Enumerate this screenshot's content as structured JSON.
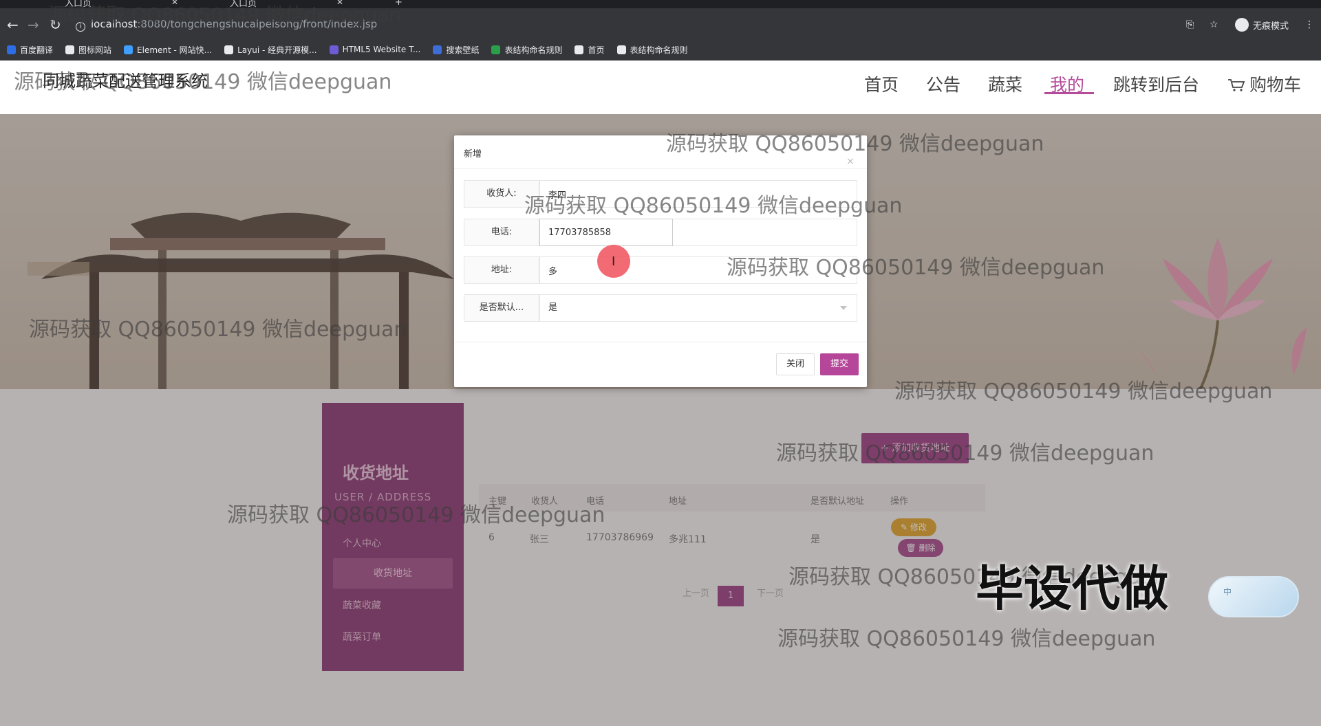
{
  "browser": {
    "tabs": [
      {
        "title": "入口页"
      },
      {
        "title": "入口页"
      }
    ],
    "url_host": "localhost",
    "url_path": ":8080/tongchengshucaipeisong/front/index.jsp",
    "profile_label": "无痕模式",
    "bookmarks": [
      {
        "label": "百度翻译",
        "color": "#2d6ee6"
      },
      {
        "label": "图标网站",
        "color": "#e8eaed"
      },
      {
        "label": "Element - 网站快...",
        "color": "#409eff"
      },
      {
        "label": "Layui - 经典开源模...",
        "color": "#e8eaed"
      },
      {
        "label": "HTML5 Website T...",
        "color": "#6f5bd6"
      },
      {
        "label": "搜索壁纸",
        "color": "#3f6dd8"
      },
      {
        "label": "表结构命名规则",
        "color": "#2aa04a"
      },
      {
        "label": "首页",
        "color": "#e8eaed"
      },
      {
        "label": "表结构命名规则",
        "color": "#e8eaed"
      }
    ]
  },
  "site": {
    "brand": "同城蔬菜配送管理系统",
    "nav": [
      {
        "label": "首页"
      },
      {
        "label": "公告"
      },
      {
        "label": "蔬菜"
      },
      {
        "label": "我的",
        "active": true
      },
      {
        "label": "跳转到后台"
      },
      {
        "label": "购物车"
      }
    ],
    "accent_color": "#b54b9a"
  },
  "sidebar": {
    "title": "收货地址",
    "subtitle": "USER / ADDRESS",
    "items": [
      {
        "label": "个人中心"
      },
      {
        "label": "收货地址",
        "selected": true
      },
      {
        "label": "蔬菜收藏"
      },
      {
        "label": "蔬菜订单"
      }
    ]
  },
  "address_table": {
    "add_button": "添加收货地址",
    "headers": [
      "主键",
      "收货人",
      "电话",
      "地址",
      "是否默认地址",
      "操作"
    ],
    "rows": [
      {
        "id": "6",
        "name": "张三",
        "phone": "17703786969",
        "address": "多兆111",
        "is_default": "是",
        "edit": "修改",
        "delete": "删除"
      }
    ],
    "pager": {
      "prev": "上一页",
      "current": "1",
      "next": "下一页"
    }
  },
  "modal": {
    "title": "新增",
    "close_icon": "×",
    "fields": [
      {
        "label": "收货人:",
        "value": "李四"
      },
      {
        "label": "电话:",
        "value": "17703785858"
      },
      {
        "label": "地址:",
        "value": "多"
      },
      {
        "label": "是否默认...",
        "value": "是"
      }
    ],
    "close_button": "关闭",
    "submit_button": "提交"
  },
  "watermark": "源码获取 QQ86050149 微信deepguan",
  "promo_text": "毕设代做",
  "widget_text": "中"
}
